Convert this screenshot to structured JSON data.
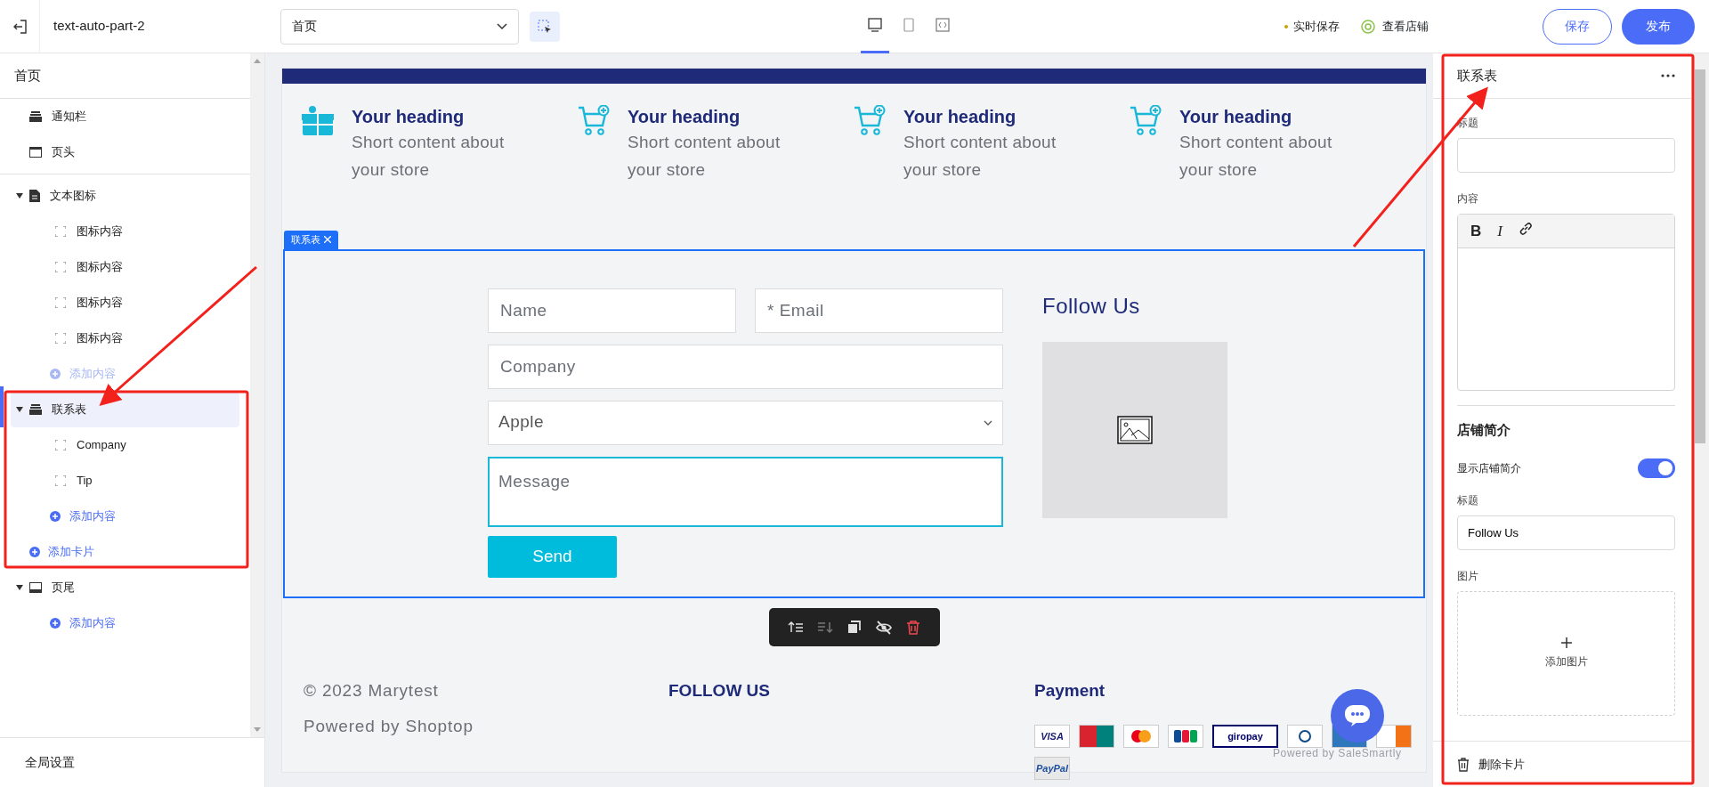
{
  "topbar": {
    "title": "text-auto-part-2",
    "page_select": "首页",
    "devices": [
      {
        "kind": "desktop",
        "selected": true
      },
      {
        "kind": "tablet",
        "selected": false
      },
      {
        "kind": "code",
        "selected": false
      }
    ],
    "autosave": "实时保存",
    "view_store": "查看店铺",
    "buttons": [
      {
        "label": "保存",
        "kind": "outline"
      },
      {
        "label": "发布",
        "kind": "primary"
      }
    ]
  },
  "sidebar": {
    "title": "首页",
    "groups": [
      {
        "items": [
          {
            "label": "通知栏",
            "kind": "bar",
            "selected": false
          },
          {
            "label": "页头",
            "kind": "header",
            "selected": false
          }
        ]
      },
      {
        "items": [
          {
            "label": "文本图标",
            "kind": "text",
            "selected": false,
            "expanded": true,
            "children": [
              {
                "label": "图标内容"
              },
              {
                "label": "图标内容"
              },
              {
                "label": "图标内容"
              },
              {
                "label": "图标内容"
              }
            ],
            "add": {
              "label": "添加内容",
              "disabled": true
            }
          },
          {
            "label": "联系表",
            "kind": "bar",
            "selected": true,
            "expanded": true,
            "children": [
              {
                "label": "Company"
              },
              {
                "label": "Tip"
              }
            ],
            "add": {
              "label": "添加内容",
              "disabled": false
            },
            "add_card": "添加卡片"
          },
          {
            "label": "页尾",
            "kind": "footer",
            "selected": false,
            "expanded": true,
            "add": {
              "label": "添加内容",
              "disabled": false
            }
          }
        ]
      }
    ],
    "footer": "全局设置"
  },
  "canvas": {
    "features": [
      {
        "heading": "Your heading",
        "text": "Short content about your store"
      },
      {
        "heading": "Your heading",
        "text": "Short content about your store"
      },
      {
        "heading": "Your heading",
        "text": "Short content about your store"
      },
      {
        "heading": "Your heading",
        "text": "Short content about your store"
      }
    ],
    "contact": {
      "tag": "联系表",
      "fields": [
        {
          "kind": "input",
          "placeholder": "Name"
        },
        {
          "kind": "input",
          "placeholder": "* Email"
        },
        {
          "kind": "input",
          "placeholder": "Company"
        },
        {
          "kind": "select",
          "value": "Apple"
        },
        {
          "kind": "textarea",
          "placeholder": "Message",
          "focused": true
        }
      ],
      "submit": "Send",
      "follow_title": "Follow Us"
    },
    "toolbar": [
      {
        "disabled": false
      },
      {
        "disabled": true
      },
      {
        "disabled": false
      },
      {
        "disabled": false
      },
      {
        "disabled": false
      }
    ],
    "footer": {
      "copyright": "© 2023 Marytest",
      "powered": "Powered by Shoptop",
      "follow_heading": "FOLLOW US",
      "payment_heading": "Payment",
      "payment_methods": [
        {
          "kind": "visa",
          "label": "VISA"
        },
        {
          "kind": "unionpay"
        },
        {
          "kind": "mastercard"
        },
        {
          "kind": "jcb"
        },
        {
          "kind": "giropay",
          "label": "giropay"
        },
        {
          "kind": "diners"
        },
        {
          "kind": "amex"
        },
        {
          "kind": "discover"
        },
        {
          "kind": "paypal",
          "label": "PayPal"
        }
      ],
      "chat_credit": "Powered by SaleSmartly"
    }
  },
  "panel": {
    "title": "联系表",
    "fields": [
      {
        "kind": "input",
        "label": "标题"
      },
      {
        "kind": "editor",
        "label": "内容",
        "tools": [
          {
            "kind": "bold",
            "glyph": "B"
          },
          {
            "kind": "italic",
            "glyph": "I"
          },
          {
            "kind": "link"
          }
        ]
      }
    ],
    "section": "店铺简介",
    "toggle": {
      "label": "显示店铺简介",
      "on": true
    },
    "fields2": [
      {
        "kind": "input",
        "label": "标题",
        "value": "Follow Us"
      },
      {
        "kind": "upload",
        "label": "图片",
        "button": "添加图片"
      }
    ],
    "footer": "删除卡片"
  }
}
